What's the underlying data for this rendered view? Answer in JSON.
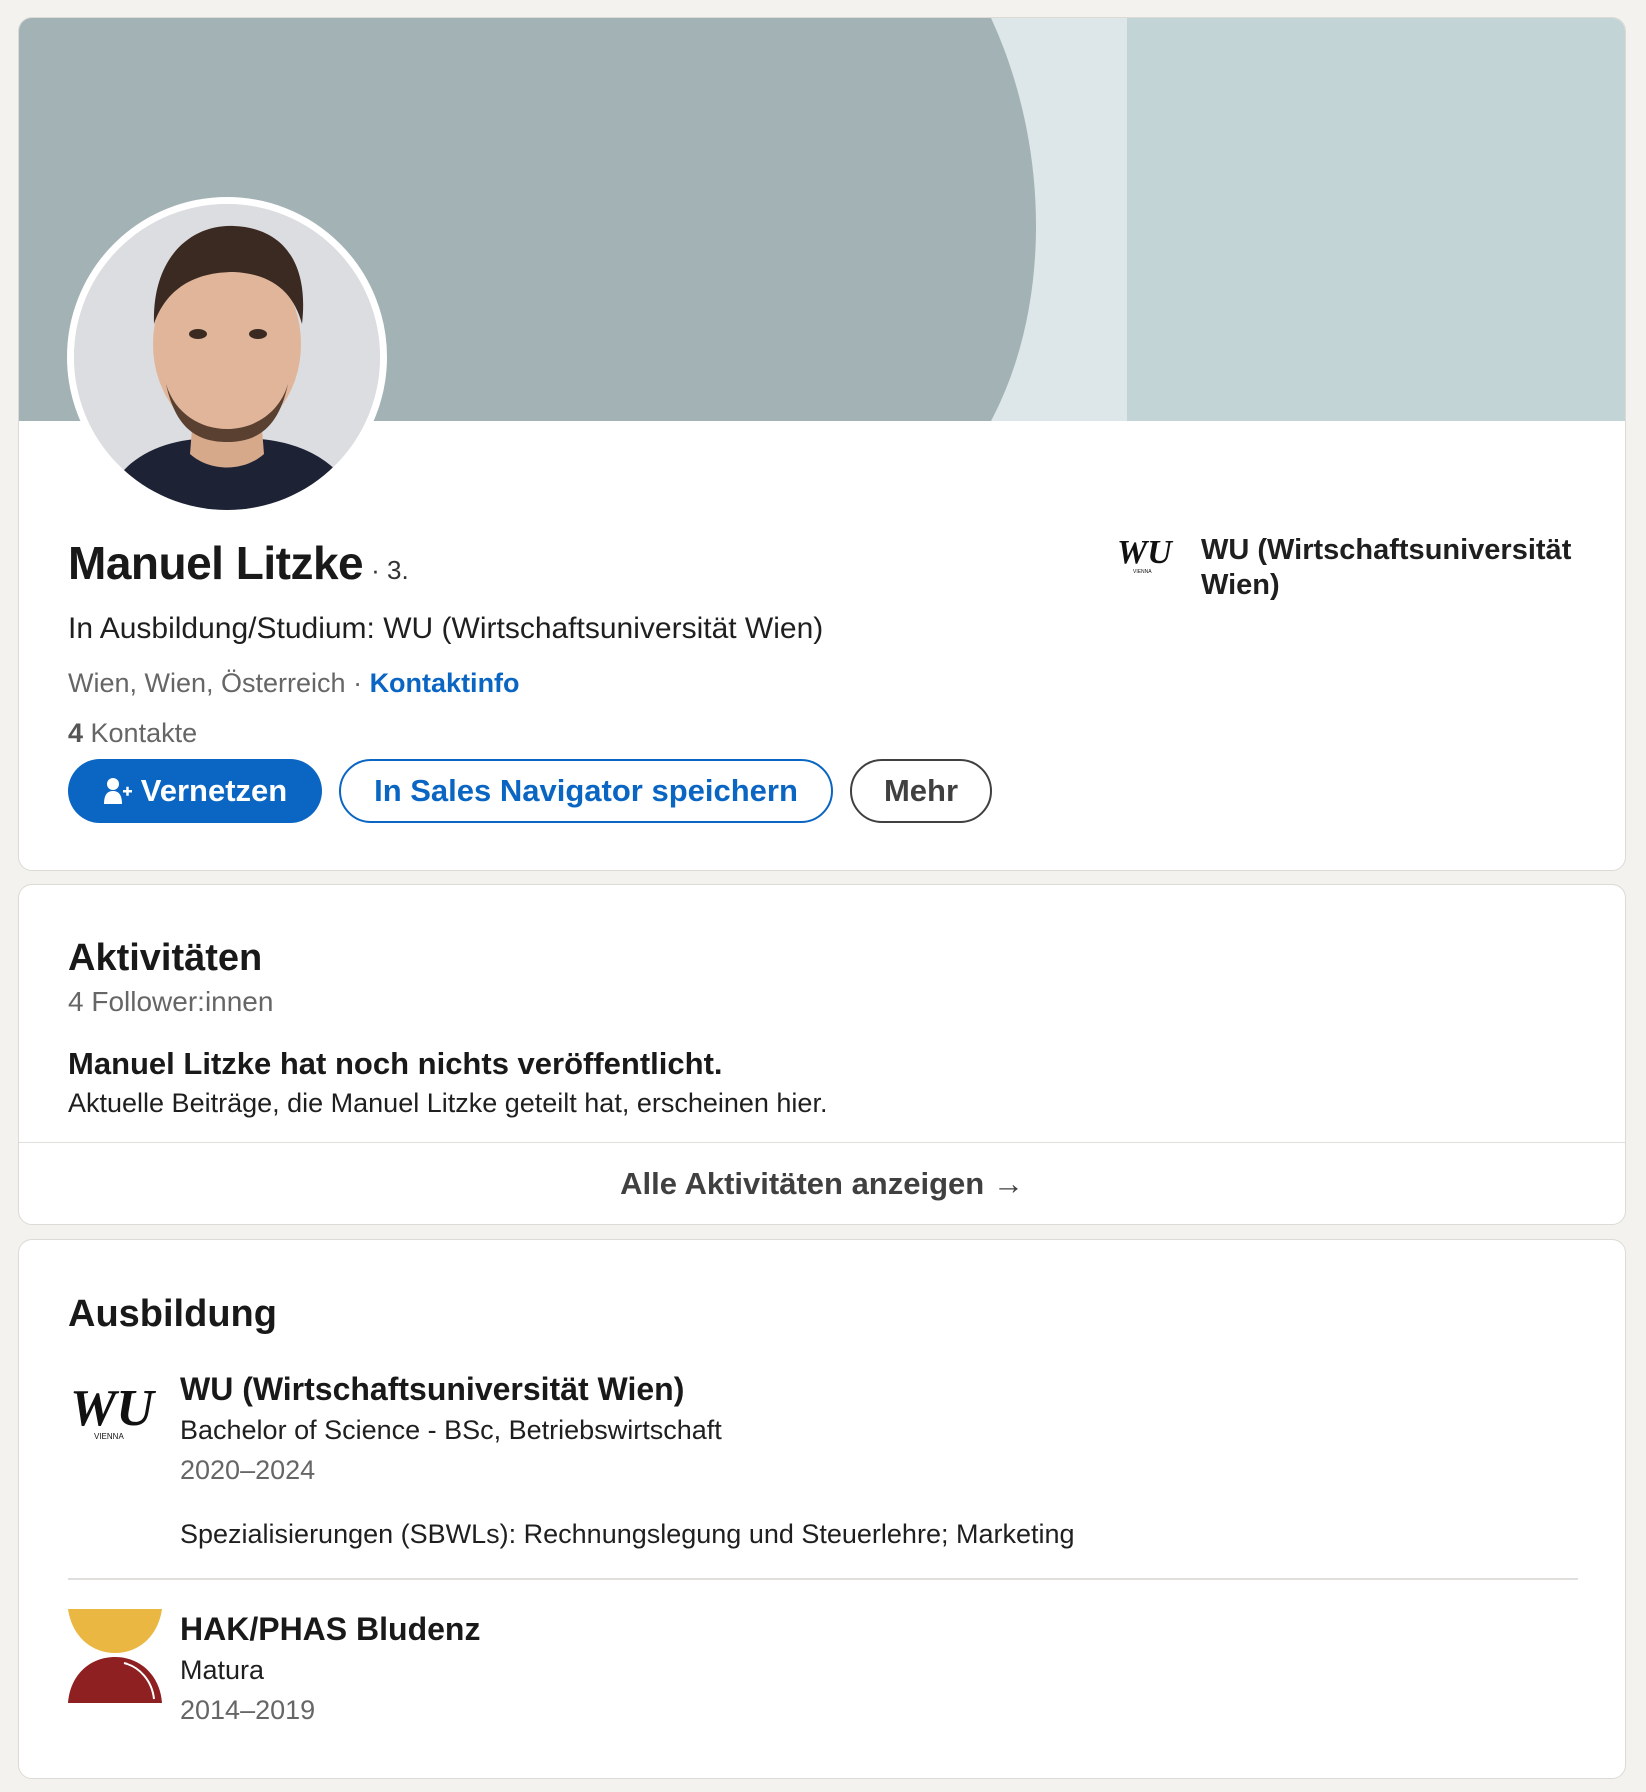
{
  "profile": {
    "name": "Manuel Litzke",
    "degree": "· 3.",
    "headline": "In Ausbildung/Studium: WU (Wirtschaftsuniversität Wien)",
    "location": "Wien, Wien, Österreich · ",
    "contact_link": "Kontaktinfo",
    "connections_count": "4",
    "connections_label": " Kontakte",
    "buttons": {
      "connect": "Vernetzen",
      "save_sales_navigator": "In Sales Navigator speichern",
      "more": "Mehr"
    },
    "top_school": "WU (Wirtschaftsuniversität Wien)"
  },
  "activities": {
    "title": "Aktivitäten",
    "followers": "4 Follower:innen",
    "empty_title": "Manuel Litzke hat noch nichts veröffentlicht.",
    "empty_text": "Aktuelle Beiträge, die Manuel Litzke geteilt hat, erscheinen hier.",
    "show_all": "Alle Aktivitäten anzeigen →"
  },
  "education": {
    "title": "Ausbildung",
    "items": [
      {
        "school": "WU (Wirtschaftsuniversität Wien)",
        "degree": "Bachelor of Science - BSc, Betriebswirtschaft",
        "years": "2020–2024",
        "description": "Spezialisierungen (SBWLs): Rechnungslegung und Steuerlehre; Marketing",
        "logo": "wu-logo"
      },
      {
        "school": "HAK/PHAS Bludenz",
        "degree": "Matura",
        "years": "2014–2019",
        "logo": "hak-logo"
      }
    ]
  },
  "logos": {
    "wu_mark": "WU",
    "wu_sub": "VIENNA"
  },
  "colors": {
    "accent": "#0a66c2",
    "banner_dark": "#a3b2b5",
    "banner_light": "#c3d4d7",
    "hak_yellow": "#eab842",
    "hak_red": "#8f2021"
  }
}
